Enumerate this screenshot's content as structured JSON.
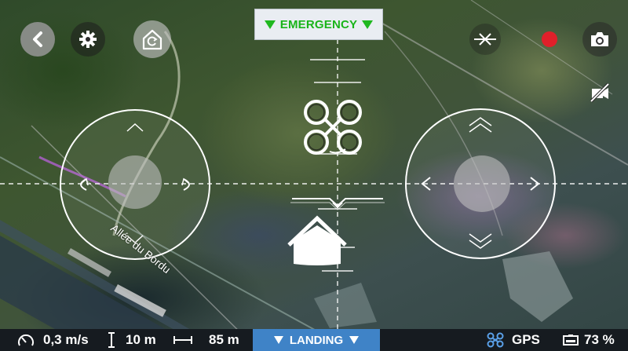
{
  "emergency": {
    "label": "EMERGENCY"
  },
  "map": {
    "street_label": "Allée du Bordu"
  },
  "status": {
    "speed": "0,3 m/s",
    "altitude": "10 m",
    "distance": "85 m",
    "landing_label": "LANDING",
    "gps_label": "GPS",
    "battery": "73 %"
  },
  "icons": {
    "back": "chevron-left-icon",
    "settings": "gear-icon",
    "home": "home-return-icon",
    "crosshair": "crosshair-icon",
    "record": "record-icon",
    "camera": "camera-icon",
    "video_off": "video-off-icon",
    "drone": "drone-icon",
    "speedometer": "speedometer-icon",
    "altitude": "altitude-icon",
    "distance": "distance-icon",
    "gps": "drone-gps-icon",
    "battery": "battery-icon"
  },
  "colors": {
    "emergency_text": "#19b419",
    "landing_bg": "#3f83c7",
    "record": "#e0202a",
    "status_bar_bg": "#161b20"
  }
}
